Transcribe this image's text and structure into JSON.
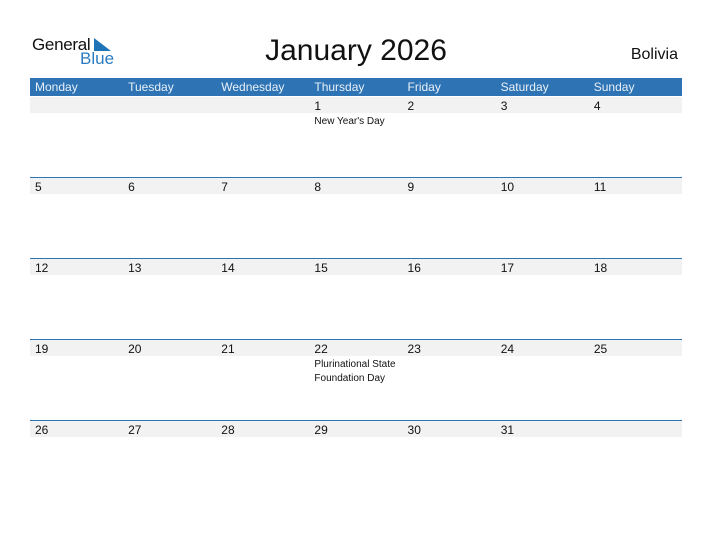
{
  "logo": {
    "general": "General",
    "blue": "Blue"
  },
  "title": "January 2026",
  "country": "Bolivia",
  "weekdays": [
    "Monday",
    "Tuesday",
    "Wednesday",
    "Thursday",
    "Friday",
    "Saturday",
    "Sunday"
  ],
  "weeks": [
    [
      {
        "d": ""
      },
      {
        "d": ""
      },
      {
        "d": ""
      },
      {
        "d": "1",
        "h": "New Year's Day"
      },
      {
        "d": "2"
      },
      {
        "d": "3"
      },
      {
        "d": "4"
      }
    ],
    [
      {
        "d": "5"
      },
      {
        "d": "6"
      },
      {
        "d": "7"
      },
      {
        "d": "8"
      },
      {
        "d": "9"
      },
      {
        "d": "10"
      },
      {
        "d": "11"
      }
    ],
    [
      {
        "d": "12"
      },
      {
        "d": "13"
      },
      {
        "d": "14"
      },
      {
        "d": "15"
      },
      {
        "d": "16"
      },
      {
        "d": "17"
      },
      {
        "d": "18"
      }
    ],
    [
      {
        "d": "19"
      },
      {
        "d": "20"
      },
      {
        "d": "21"
      },
      {
        "d": "22",
        "h": "Plurinational State Foundation Day"
      },
      {
        "d": "23"
      },
      {
        "d": "24"
      },
      {
        "d": "25"
      }
    ],
    [
      {
        "d": "26"
      },
      {
        "d": "27"
      },
      {
        "d": "28"
      },
      {
        "d": "29"
      },
      {
        "d": "30"
      },
      {
        "d": "31"
      },
      {
        "d": ""
      }
    ]
  ],
  "colors": {
    "accent": "#2e74b5",
    "band": "#f2f2f2"
  }
}
